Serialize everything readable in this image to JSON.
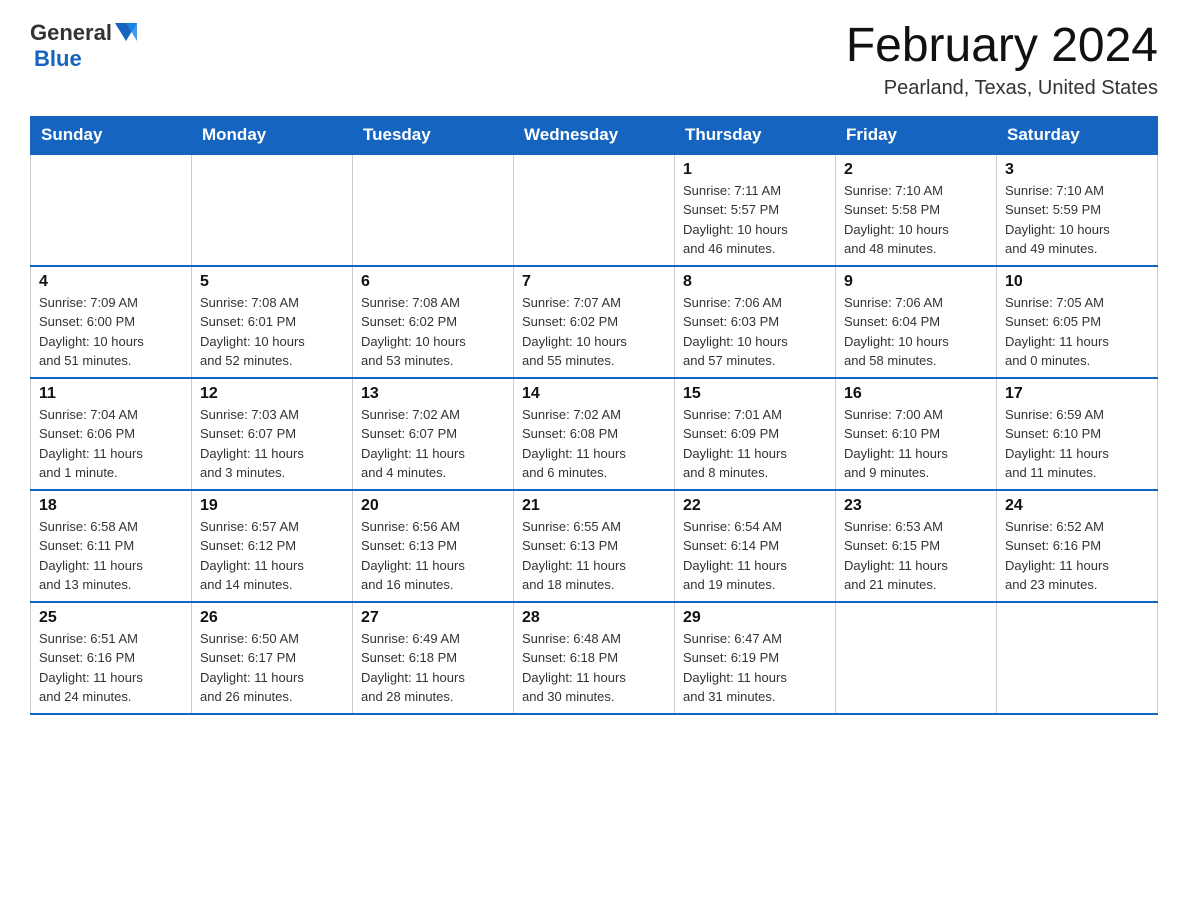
{
  "header": {
    "title": "February 2024",
    "location": "Pearland, Texas, United States",
    "logo_general": "General",
    "logo_blue": "Blue"
  },
  "days_of_week": [
    "Sunday",
    "Monday",
    "Tuesday",
    "Wednesday",
    "Thursday",
    "Friday",
    "Saturday"
  ],
  "weeks": [
    {
      "days": [
        {
          "number": "",
          "info": ""
        },
        {
          "number": "",
          "info": ""
        },
        {
          "number": "",
          "info": ""
        },
        {
          "number": "",
          "info": ""
        },
        {
          "number": "1",
          "info": "Sunrise: 7:11 AM\nSunset: 5:57 PM\nDaylight: 10 hours\nand 46 minutes."
        },
        {
          "number": "2",
          "info": "Sunrise: 7:10 AM\nSunset: 5:58 PM\nDaylight: 10 hours\nand 48 minutes."
        },
        {
          "number": "3",
          "info": "Sunrise: 7:10 AM\nSunset: 5:59 PM\nDaylight: 10 hours\nand 49 minutes."
        }
      ]
    },
    {
      "days": [
        {
          "number": "4",
          "info": "Sunrise: 7:09 AM\nSunset: 6:00 PM\nDaylight: 10 hours\nand 51 minutes."
        },
        {
          "number": "5",
          "info": "Sunrise: 7:08 AM\nSunset: 6:01 PM\nDaylight: 10 hours\nand 52 minutes."
        },
        {
          "number": "6",
          "info": "Sunrise: 7:08 AM\nSunset: 6:02 PM\nDaylight: 10 hours\nand 53 minutes."
        },
        {
          "number": "7",
          "info": "Sunrise: 7:07 AM\nSunset: 6:02 PM\nDaylight: 10 hours\nand 55 minutes."
        },
        {
          "number": "8",
          "info": "Sunrise: 7:06 AM\nSunset: 6:03 PM\nDaylight: 10 hours\nand 57 minutes."
        },
        {
          "number": "9",
          "info": "Sunrise: 7:06 AM\nSunset: 6:04 PM\nDaylight: 10 hours\nand 58 minutes."
        },
        {
          "number": "10",
          "info": "Sunrise: 7:05 AM\nSunset: 6:05 PM\nDaylight: 11 hours\nand 0 minutes."
        }
      ]
    },
    {
      "days": [
        {
          "number": "11",
          "info": "Sunrise: 7:04 AM\nSunset: 6:06 PM\nDaylight: 11 hours\nand 1 minute."
        },
        {
          "number": "12",
          "info": "Sunrise: 7:03 AM\nSunset: 6:07 PM\nDaylight: 11 hours\nand 3 minutes."
        },
        {
          "number": "13",
          "info": "Sunrise: 7:02 AM\nSunset: 6:07 PM\nDaylight: 11 hours\nand 4 minutes."
        },
        {
          "number": "14",
          "info": "Sunrise: 7:02 AM\nSunset: 6:08 PM\nDaylight: 11 hours\nand 6 minutes."
        },
        {
          "number": "15",
          "info": "Sunrise: 7:01 AM\nSunset: 6:09 PM\nDaylight: 11 hours\nand 8 minutes."
        },
        {
          "number": "16",
          "info": "Sunrise: 7:00 AM\nSunset: 6:10 PM\nDaylight: 11 hours\nand 9 minutes."
        },
        {
          "number": "17",
          "info": "Sunrise: 6:59 AM\nSunset: 6:10 PM\nDaylight: 11 hours\nand 11 minutes."
        }
      ]
    },
    {
      "days": [
        {
          "number": "18",
          "info": "Sunrise: 6:58 AM\nSunset: 6:11 PM\nDaylight: 11 hours\nand 13 minutes."
        },
        {
          "number": "19",
          "info": "Sunrise: 6:57 AM\nSunset: 6:12 PM\nDaylight: 11 hours\nand 14 minutes."
        },
        {
          "number": "20",
          "info": "Sunrise: 6:56 AM\nSunset: 6:13 PM\nDaylight: 11 hours\nand 16 minutes."
        },
        {
          "number": "21",
          "info": "Sunrise: 6:55 AM\nSunset: 6:13 PM\nDaylight: 11 hours\nand 18 minutes."
        },
        {
          "number": "22",
          "info": "Sunrise: 6:54 AM\nSunset: 6:14 PM\nDaylight: 11 hours\nand 19 minutes."
        },
        {
          "number": "23",
          "info": "Sunrise: 6:53 AM\nSunset: 6:15 PM\nDaylight: 11 hours\nand 21 minutes."
        },
        {
          "number": "24",
          "info": "Sunrise: 6:52 AM\nSunset: 6:16 PM\nDaylight: 11 hours\nand 23 minutes."
        }
      ]
    },
    {
      "days": [
        {
          "number": "25",
          "info": "Sunrise: 6:51 AM\nSunset: 6:16 PM\nDaylight: 11 hours\nand 24 minutes."
        },
        {
          "number": "26",
          "info": "Sunrise: 6:50 AM\nSunset: 6:17 PM\nDaylight: 11 hours\nand 26 minutes."
        },
        {
          "number": "27",
          "info": "Sunrise: 6:49 AM\nSunset: 6:18 PM\nDaylight: 11 hours\nand 28 minutes."
        },
        {
          "number": "28",
          "info": "Sunrise: 6:48 AM\nSunset: 6:18 PM\nDaylight: 11 hours\nand 30 minutes."
        },
        {
          "number": "29",
          "info": "Sunrise: 6:47 AM\nSunset: 6:19 PM\nDaylight: 11 hours\nand 31 minutes."
        },
        {
          "number": "",
          "info": ""
        },
        {
          "number": "",
          "info": ""
        }
      ]
    }
  ]
}
